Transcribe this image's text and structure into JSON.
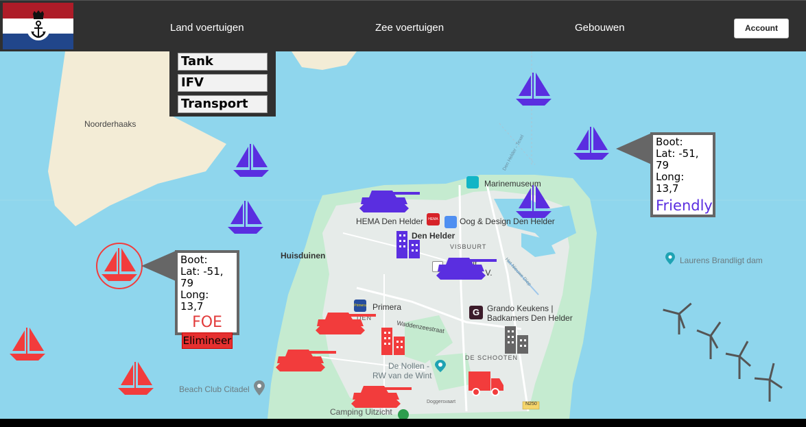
{
  "header": {
    "nav": [
      "Land voertuigen",
      "Zee voertuigen",
      "Gebouwen"
    ],
    "account_label": "Account"
  },
  "dropdown": {
    "items": [
      "Tank",
      "IFV",
      "Transport"
    ]
  },
  "map": {
    "labels": {
      "noorderhaaks": "Noorderhaaks",
      "marinemuseum": "Marinemuseum",
      "hema": "HEMA Den Helder",
      "hema_badge": "HEMA",
      "oog": "Oog & Design Den Helder",
      "den_helder": "Den Helder",
      "visbuurt": "VISBUURT",
      "huisduinen": "Huisduinen",
      "bedrijf": "drijf",
      "bet": "bet B.V.",
      "laurens": "Laurens Brandligt dam",
      "primera": "Primera",
      "primera_badge": "Primera",
      "grando1": "Grando Keukens |",
      "grando2": "Badkamers Den Helder",
      "grando_badge": "G",
      "waddenzee": "Waddenzeestraat",
      "schooten": "DE SCHOOTEN",
      "nollen1": "De Nollen -",
      "nollen2": "RW van de Wint",
      "beachclub": "Beach Club Citadel",
      "camping": "Camping Uitzicht",
      "n250": "N250",
      "ferry": "Den Helder - Texel",
      "den_partial": "DEN",
      "dogger": "Doggersvaart",
      "nollen_road": "Het Nieuwe Diep"
    },
    "colors": {
      "friendly": "#5a2ee0",
      "foe": "#f23c3c",
      "neutral": "#666666",
      "water": "#8fd6ed",
      "land": "#f3ecd6",
      "urban": "#e6ebe9",
      "green": "#c5ebd0"
    }
  },
  "info_friendly": {
    "title": "Boot:",
    "lat": "Lat: -51, 79",
    "long": "Long: 13,7",
    "status": "Friendly"
  },
  "info_foe": {
    "title": "Boot:",
    "lat": "Lat: -51, 79",
    "long": "Long: 13,7",
    "status": "FOE",
    "action": "Elimineer"
  }
}
